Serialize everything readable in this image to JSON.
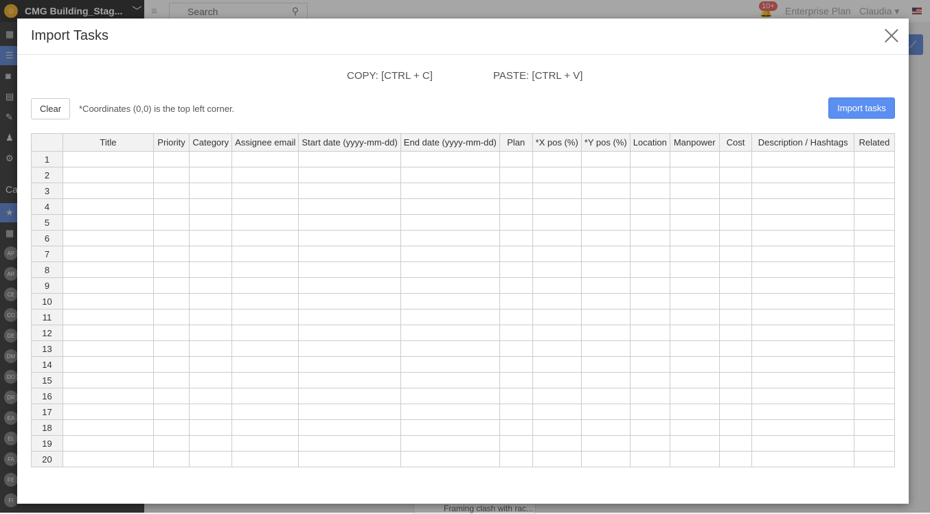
{
  "app": {
    "project_name": "CMG Building_Stag...",
    "search_placeholder": "Search",
    "notifications": "10+",
    "plan": "Enterprise Plan",
    "user": "Claudia",
    "sidebar_section_label": "Ca",
    "sidebar_badges": [
      "AP",
      "AR",
      "CE",
      "CO",
      "DE",
      "DM",
      "DO",
      "DR",
      "EA",
      "EL",
      "FA",
      "FE",
      "FI"
    ],
    "bottom_card_text": "Framing clash with rac..."
  },
  "modal": {
    "title": "Import Tasks",
    "copy_hint": "COPY: [CTRL + C]",
    "paste_hint": "PASTE: [CTRL + V]",
    "clear_label": "Clear",
    "coord_note": "*Coordinates (0,0) is the top left corner.",
    "import_label": "Import tasks",
    "grid": {
      "columns": [
        "Title",
        "Priority",
        "Category",
        "Assignee email",
        "Start date (yyyy-mm-dd)",
        "End date (yyyy-mm-dd)",
        "Plan",
        "*X pos (%)",
        "*Y pos (%)",
        "Location",
        "Manpower",
        "Cost",
        "Description / Hashtags",
        "Related"
      ],
      "rows": [
        "1",
        "2",
        "3",
        "4",
        "5",
        "6",
        "7",
        "8",
        "9",
        "10",
        "11",
        "12",
        "13",
        "14",
        "15",
        "16",
        "17",
        "18",
        "19",
        "20"
      ]
    }
  },
  "colors": {
    "primary": "#5b8ff0",
    "sidebar": "#4a4a4a",
    "badge": "#f06a6a"
  }
}
